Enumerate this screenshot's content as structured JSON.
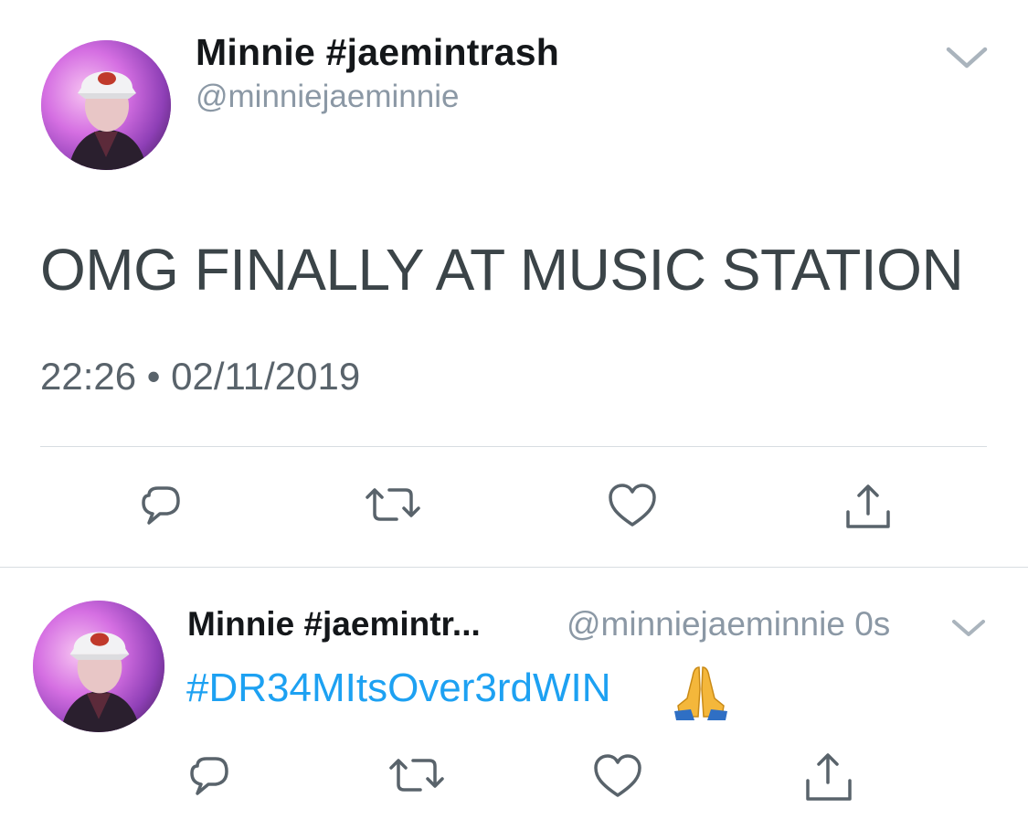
{
  "main_tweet": {
    "display_name": "Minnie #jaemintrash",
    "handle": "@minniejaeminnie",
    "text": "OMG FINALLY AT MUSIC STATION",
    "timestamp": "22:26 • 02/11/2019",
    "actions": [
      "reply-icon",
      "retweet-icon",
      "like-icon",
      "share-icon"
    ]
  },
  "reply_tweet": {
    "display_name": "Minnie #jaemintr...",
    "handle_time": "@minniejaeminnie 0s",
    "hashtag": "#DR34MItsOver3rdWIN",
    "emoji": "folded-hands-emoji",
    "actions": [
      "reply-icon",
      "retweet-icon",
      "like-icon",
      "share-icon"
    ]
  },
  "colors": {
    "link": "#1da1f2",
    "secondary_text": "#8b98a5",
    "icon": "#59636b",
    "divider": "#d8dde1"
  }
}
